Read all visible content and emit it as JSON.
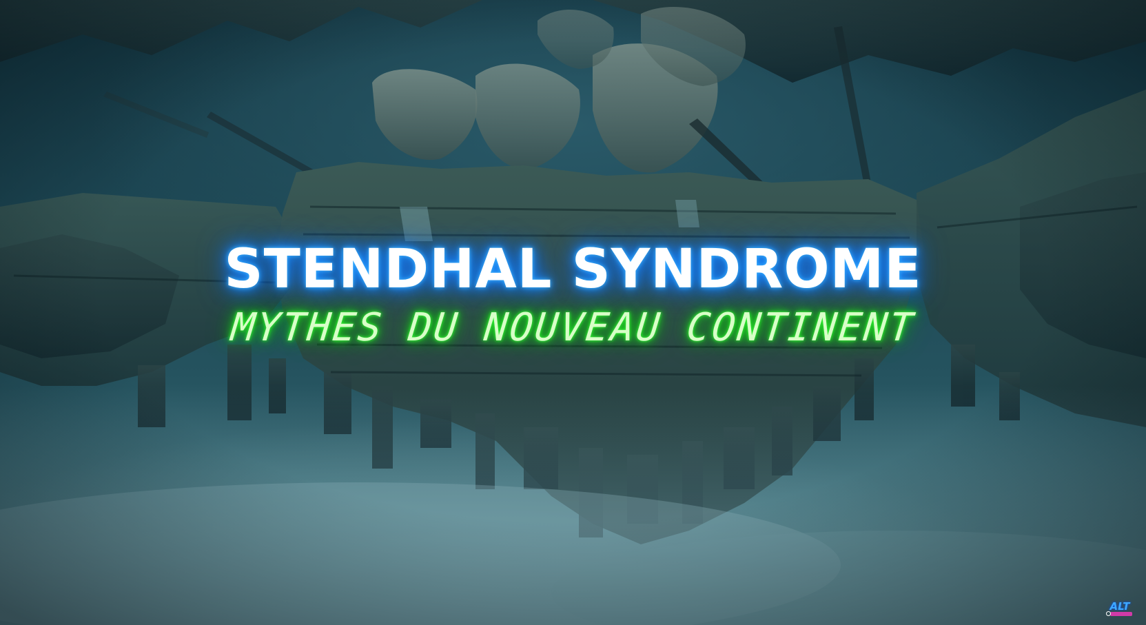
{
  "title_card": {
    "title": "STENDHAL SYNDROME",
    "subtitle": "MYTHES DU NOUVEAU CONTINENT"
  },
  "watermark": {
    "logo_text": "ALT",
    "icon": "channel-logo-icon"
  },
  "colors": {
    "title_glow": "#1d8fff",
    "subtitle_glow": "#1ee61e",
    "background": "#1d4754",
    "watermark_accent": "#d23aa8"
  }
}
